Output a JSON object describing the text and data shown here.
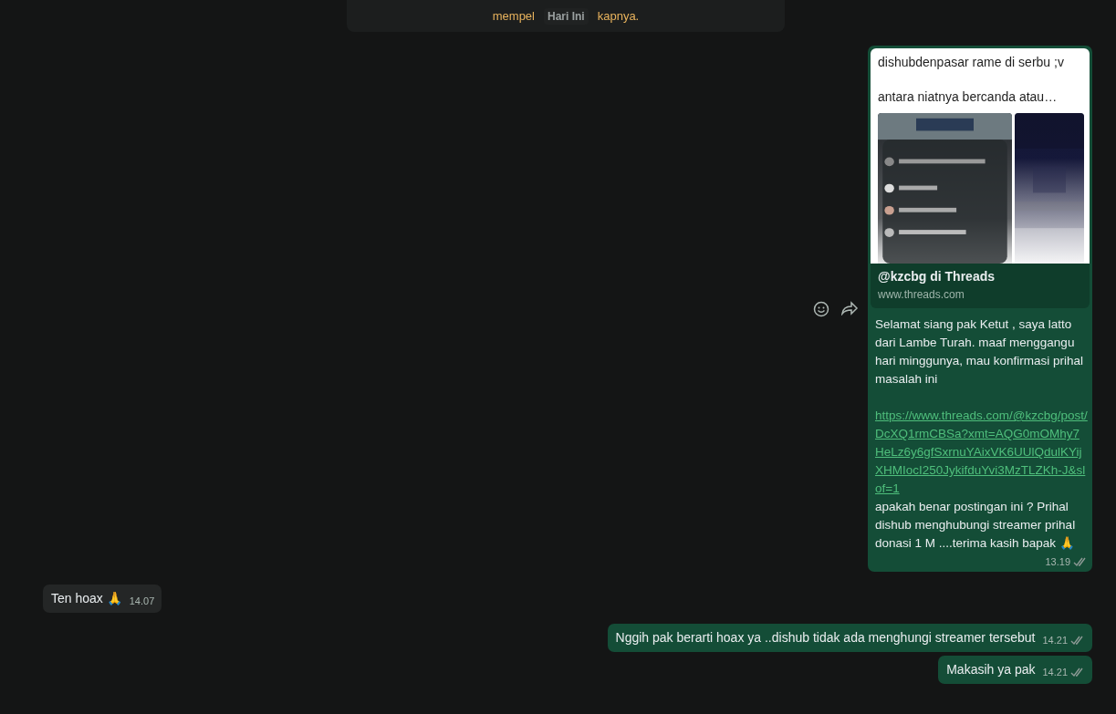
{
  "top_message": {
    "text_before": "mempel",
    "date_chip": "Hari Ini",
    "text_after": "kapnya."
  },
  "messages": [
    {
      "kind": "link_preview",
      "outgoing": true,
      "preview": {
        "description_lines": [
          "dishubdenpasar rame di serbu ;v",
          "antara niatnya bercanda atau…"
        ],
        "title": "@kzcbg di Threads",
        "domain": "www.threads.com"
      },
      "text": "Selamat siang pak Ketut , saya latto dari Lambe Turah. maaf menggangu hari minggunya, mau konfirmasi prihal masalah ini",
      "link": "https://www.threads.com/@kzcbg/post/DcXQ1rmCBSa?xmt=AQG0mOMhy7HeLz6y6gfSxrnuYAixVK6UUlQdulKYijXHMIocI250JykifduYvi3MzTLZKh-J&slof=1",
      "text_after": "apakah benar postingan ini ? Prihal dishub menghubungi streamer prihal donasi 1 M ....terima kasih bapak 🙏",
      "time": "13.19",
      "read": false,
      "hovered": true
    },
    {
      "kind": "text",
      "outgoing": false,
      "text": "Ten hoax 🙏",
      "time": "14.07"
    },
    {
      "kind": "text",
      "outgoing": true,
      "text": "Nggih pak berarti hoax ya ..dishub tidak ada menghungi streamer tersebut",
      "time": "14.21",
      "read": false
    },
    {
      "kind": "text",
      "outgoing": true,
      "text": "Makasih ya pak",
      "time": "14.21",
      "read": false
    }
  ]
}
